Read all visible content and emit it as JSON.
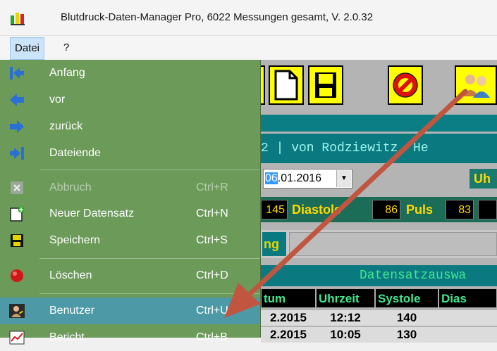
{
  "window": {
    "title": "Blutdruck-Daten-Manager Pro, 6022 Messungen gesamt, V. 2.0.32"
  },
  "menubar": {
    "items": [
      "Datei",
      "?"
    ]
  },
  "file_menu": {
    "items": [
      {
        "label": "Anfang",
        "shortcut": ""
      },
      {
        "label": "vor",
        "shortcut": ""
      },
      {
        "label": "zurück",
        "shortcut": ""
      },
      {
        "label": "Dateiende",
        "shortcut": ""
      },
      {
        "label": "Abbruch",
        "shortcut": "Ctrl+R",
        "disabled": true
      },
      {
        "label": "Neuer Datensatz",
        "shortcut": "Ctrl+N"
      },
      {
        "label": "Speichern",
        "shortcut": "Ctrl+S"
      },
      {
        "label": "Löschen",
        "shortcut": "Ctrl+D"
      },
      {
        "label": "Benutzer",
        "shortcut": "Ctrl+U",
        "highlighted": true
      },
      {
        "label": "Bericht",
        "shortcut": "Ctrl+B"
      }
    ]
  },
  "background": {
    "header_text": "2 | von Rodziewitz, He",
    "date_selected": "06",
    "date_rest": ".01.2016",
    "uhr_label": "Uh",
    "systole_value": "145",
    "diastole_label": "Diastole",
    "diastole_value": "86",
    "puls_label": "Puls",
    "puls_value": "83",
    "ng_label": "ng",
    "datensatz_title": "Datensatzauswa",
    "table": {
      "headers": [
        "tum",
        "Uhrzeit",
        "Systole",
        "Dias"
      ],
      "rows": [
        [
          "2.2015",
          "12:12",
          "140",
          ""
        ],
        [
          "2.2015",
          "10:05",
          "130",
          ""
        ]
      ]
    }
  },
  "colors": {
    "menu_bg": "#6b9a59",
    "menu_highlight": "#4d9aa6",
    "toolbar_yellow": "#ffff00",
    "teal": "#0a7a80",
    "annotation_arrow": "#c0563f"
  }
}
